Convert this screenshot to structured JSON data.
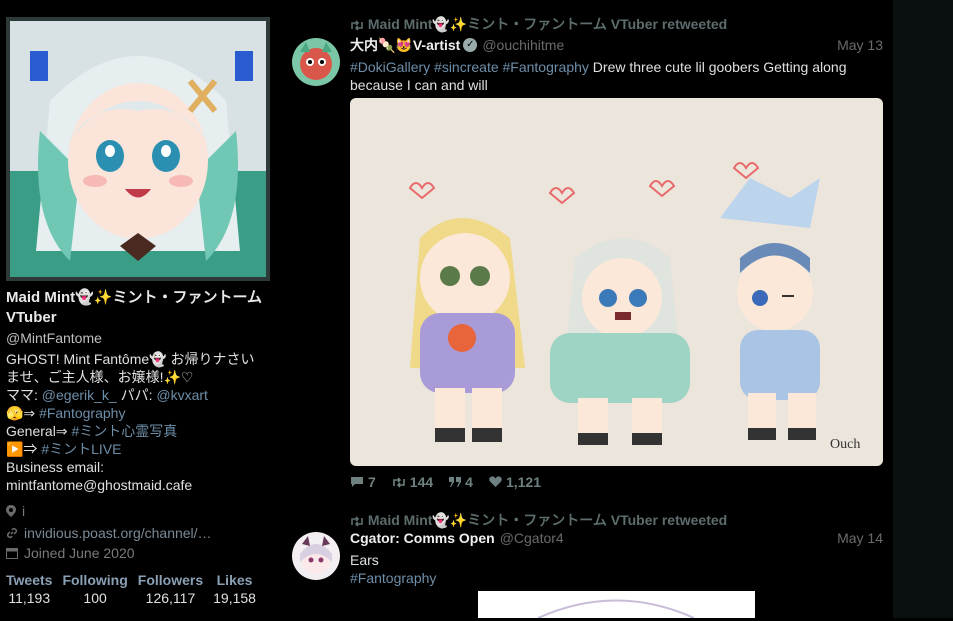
{
  "profile": {
    "display_name": "Maid Mint👻✨ミント・ファントーム VTuber",
    "handle": "@MintFantome",
    "bio": {
      "line1": "GHOST! Mint Fantôme👻 お帰りナさい",
      "line2": "ませ、ご主人様、お嬢様!✨♡",
      "mama_label": "ママ: ",
      "mama_link": "@egerik_k_",
      "papa_label": " パパ: ",
      "papa_link": "@kvxart",
      "art_prefix": "🫣⇒ ",
      "art_tag": "#Fantography",
      "general_prefix": "General⇒ ",
      "general_tag": "#ミント心霊写真",
      "live_prefix": "▶️⇒ ",
      "live_tag": "#ミントLIVE",
      "email_label": "Business email:",
      "email": "mintfantome@ghostmaid.cafe"
    },
    "location": "i",
    "website": "invidious.poast.org/channel/…",
    "joined": "Joined June 2020",
    "stats": [
      {
        "label": "Tweets",
        "value": "11,193"
      },
      {
        "label": "Following",
        "value": "100"
      },
      {
        "label": "Followers",
        "value": "126,117"
      },
      {
        "label": "Likes",
        "value": "19,158"
      }
    ]
  },
  "tweets": [
    {
      "retweet_label": "Maid Mint👻✨ミント・ファントーム VTuber retweeted",
      "author": "大内🍡😻V-artist",
      "username": "@ouchihitme",
      "date": "May 13",
      "tags": "#DokiGallery #sincreate  #Fantography",
      "text": " Drew three cute lil goobers Getting along",
      "text2": "because I can and will",
      "replies": "7",
      "retweets": "144",
      "quotes": "4",
      "likes": "1,121"
    },
    {
      "retweet_label": "Maid Mint👻✨ミント・ファントーム VTuber retweeted",
      "author": "Cgator: Comms Open",
      "username": "@Cgator4",
      "date": "May 14",
      "text": "Ears",
      "tags": "#Fantography"
    }
  ],
  "colors": {
    "background": "#000000",
    "link": "#6e8ea8",
    "muted": "#6b6b6b",
    "stat_label": "#8aa0b4"
  },
  "icons": [
    "retweet-icon",
    "verified-icon",
    "location-icon",
    "link-icon",
    "calendar-icon",
    "reply-icon",
    "quote-icon",
    "heart-icon"
  ]
}
